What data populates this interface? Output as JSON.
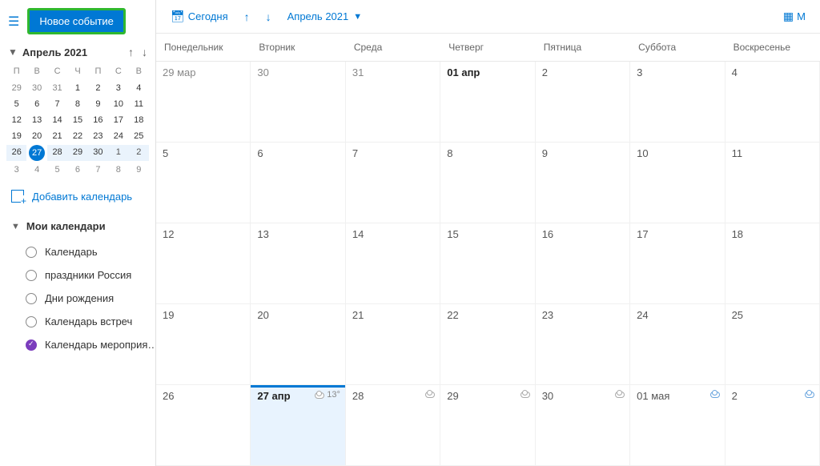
{
  "header": {
    "new_event": "Новое событие",
    "today": "Сегодня",
    "month_label": "Апрель 2021",
    "view_letter": "М"
  },
  "mini": {
    "label": "Апрель 2021",
    "dows": [
      "П",
      "В",
      "С",
      "Ч",
      "П",
      "С",
      "В"
    ],
    "weeks": [
      [
        {
          "n": "29",
          "cls": "d"
        },
        {
          "n": "30",
          "cls": "d"
        },
        {
          "n": "31",
          "cls": "d"
        },
        {
          "n": "1",
          "cls": "d in"
        },
        {
          "n": "2",
          "cls": "d in"
        },
        {
          "n": "3",
          "cls": "d in"
        },
        {
          "n": "4",
          "cls": "d in"
        }
      ],
      [
        {
          "n": "5",
          "cls": "d in"
        },
        {
          "n": "6",
          "cls": "d in"
        },
        {
          "n": "7",
          "cls": "d in"
        },
        {
          "n": "8",
          "cls": "d in"
        },
        {
          "n": "9",
          "cls": "d in"
        },
        {
          "n": "10",
          "cls": "d in"
        },
        {
          "n": "11",
          "cls": "d in"
        }
      ],
      [
        {
          "n": "12",
          "cls": "d in"
        },
        {
          "n": "13",
          "cls": "d in"
        },
        {
          "n": "14",
          "cls": "d in"
        },
        {
          "n": "15",
          "cls": "d in"
        },
        {
          "n": "16",
          "cls": "d in"
        },
        {
          "n": "17",
          "cls": "d in"
        },
        {
          "n": "18",
          "cls": "d in"
        }
      ],
      [
        {
          "n": "19",
          "cls": "d in"
        },
        {
          "n": "20",
          "cls": "d in"
        },
        {
          "n": "21",
          "cls": "d in"
        },
        {
          "n": "22",
          "cls": "d in"
        },
        {
          "n": "23",
          "cls": "d in"
        },
        {
          "n": "24",
          "cls": "d in"
        },
        {
          "n": "25",
          "cls": "d in"
        }
      ],
      [
        {
          "n": "26",
          "cls": "d in w5"
        },
        {
          "n": "27",
          "cls": "d in today"
        },
        {
          "n": "28",
          "cls": "d in w5"
        },
        {
          "n": "29",
          "cls": "d in w5"
        },
        {
          "n": "30",
          "cls": "d in w5"
        },
        {
          "n": "1",
          "cls": "d w5"
        },
        {
          "n": "2",
          "cls": "d w5"
        }
      ],
      [
        {
          "n": "3",
          "cls": "d"
        },
        {
          "n": "4",
          "cls": "d"
        },
        {
          "n": "5",
          "cls": "d"
        },
        {
          "n": "6",
          "cls": "d"
        },
        {
          "n": "7",
          "cls": "d"
        },
        {
          "n": "8",
          "cls": "d"
        },
        {
          "n": "9",
          "cls": "d"
        }
      ]
    ]
  },
  "sidebar": {
    "add_calendar": "Добавить календарь",
    "section_label": "Мои календари",
    "items": [
      {
        "label": "Календарь",
        "checked": false
      },
      {
        "label": "праздники Россия",
        "checked": false
      },
      {
        "label": "Дни рождения",
        "checked": false
      },
      {
        "label": "Календарь встреч",
        "checked": false
      },
      {
        "label": "Календарь мероприя…",
        "checked": true
      }
    ]
  },
  "grid": {
    "dows": [
      "Понедельник",
      "Вторник",
      "Среда",
      "Четверг",
      "Пятница",
      "Суббота",
      "Воскресенье"
    ],
    "rows": [
      [
        {
          "n": "29 мар",
          "cls": "cell out"
        },
        {
          "n": "30",
          "cls": "cell out"
        },
        {
          "n": "31",
          "cls": "cell out"
        },
        {
          "n": "01 апр",
          "cls": "cell bold"
        },
        {
          "n": "2",
          "cls": "cell"
        },
        {
          "n": "3",
          "cls": "cell"
        },
        {
          "n": "4",
          "cls": "cell"
        }
      ],
      [
        {
          "n": "5",
          "cls": "cell"
        },
        {
          "n": "6",
          "cls": "cell"
        },
        {
          "n": "7",
          "cls": "cell"
        },
        {
          "n": "8",
          "cls": "cell"
        },
        {
          "n": "9",
          "cls": "cell"
        },
        {
          "n": "10",
          "cls": "cell"
        },
        {
          "n": "11",
          "cls": "cell"
        }
      ],
      [
        {
          "n": "12",
          "cls": "cell"
        },
        {
          "n": "13",
          "cls": "cell"
        },
        {
          "n": "14",
          "cls": "cell"
        },
        {
          "n": "15",
          "cls": "cell"
        },
        {
          "n": "16",
          "cls": "cell"
        },
        {
          "n": "17",
          "cls": "cell"
        },
        {
          "n": "18",
          "cls": "cell"
        }
      ],
      [
        {
          "n": "19",
          "cls": "cell"
        },
        {
          "n": "20",
          "cls": "cell"
        },
        {
          "n": "21",
          "cls": "cell"
        },
        {
          "n": "22",
          "cls": "cell"
        },
        {
          "n": "23",
          "cls": "cell"
        },
        {
          "n": "24",
          "cls": "cell"
        },
        {
          "n": "25",
          "cls": "cell"
        }
      ],
      [
        {
          "n": "26",
          "cls": "cell"
        },
        {
          "n": "27 апр",
          "cls": "cell today",
          "w": "cloud",
          "temp": "13°"
        },
        {
          "n": "28",
          "cls": "cell",
          "w": "cloud"
        },
        {
          "n": "29",
          "cls": "cell",
          "w": "cloud"
        },
        {
          "n": "30",
          "cls": "cell",
          "w": "cloud"
        },
        {
          "n": "01 мая",
          "cls": "cell",
          "w": "rain"
        },
        {
          "n": "2",
          "cls": "cell",
          "w": "rain"
        }
      ]
    ]
  }
}
